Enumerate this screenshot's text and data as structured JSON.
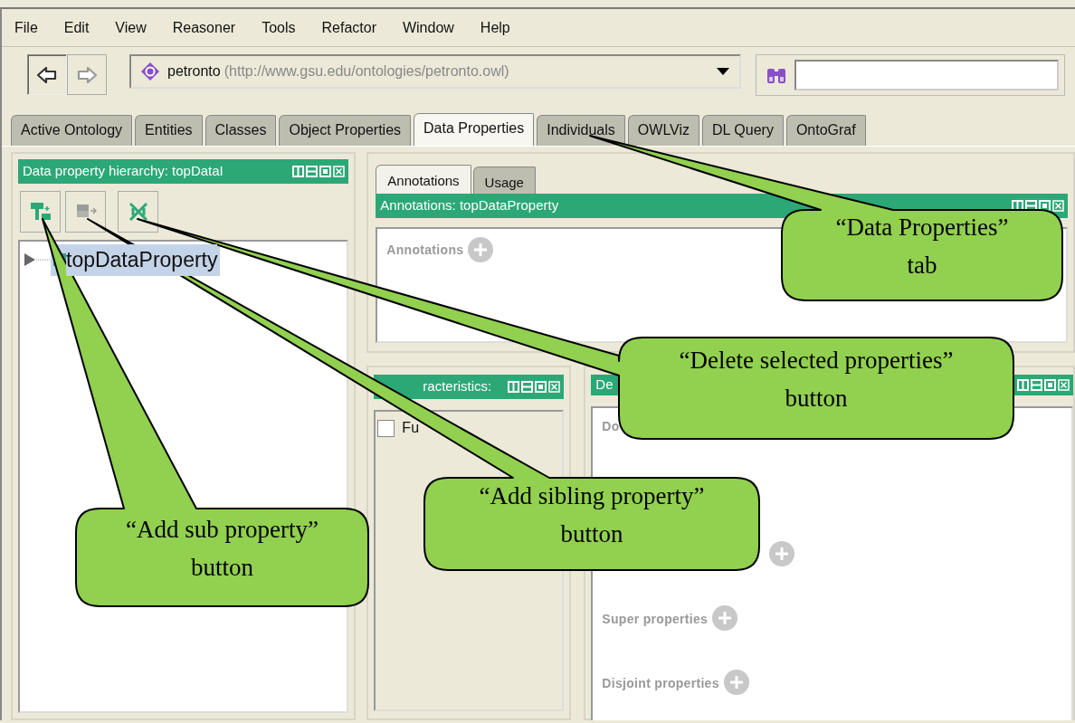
{
  "menu": [
    "File",
    "Edit",
    "View",
    "Reasoner",
    "Tools",
    "Refactor",
    "Window",
    "Help"
  ],
  "navigation": [
    {
      "kind": "back",
      "disabled": false
    },
    {
      "kind": "forward",
      "disabled": true
    }
  ],
  "ontology_selector": {
    "name": "petronto",
    "iri": "(http://www.gsu.edu/ontologies/petronto.owl)"
  },
  "tabs": [
    {
      "label": "Active Ontology",
      "selected": false
    },
    {
      "label": "Entities",
      "selected": false
    },
    {
      "label": "Classes",
      "selected": false
    },
    {
      "label": "Object Properties",
      "selected": false
    },
    {
      "label": "Data Properties",
      "selected": true
    },
    {
      "label": "Individuals",
      "selected": false
    },
    {
      "label": "OWLViz",
      "selected": false
    },
    {
      "label": "DL Query",
      "selected": false
    },
    {
      "label": "OntoGraf",
      "selected": false
    }
  ],
  "hierarchy_panel": {
    "title": "Data property hierarchy: topDataI",
    "tools": [
      {
        "kind": "add-sub",
        "disabled": false
      },
      {
        "kind": "add-sibling",
        "disabled": true
      },
      {
        "kind": "delete",
        "disabled": false
      }
    ],
    "tree": [
      {
        "label": "topDataProperty",
        "selected": true,
        "expanded": false
      }
    ]
  },
  "annotations_panel": {
    "tabs": [
      {
        "label": "Annotations",
        "selected": true
      },
      {
        "label": "Usage",
        "selected": false
      }
    ],
    "title": "Annotations: topDataProperty",
    "sections": [
      "Annotations"
    ]
  },
  "characteristics_panel": {
    "title": "racteristics:",
    "items": [
      {
        "label": "Fu",
        "checked": false
      }
    ]
  },
  "description_panel": {
    "title": "De",
    "sections": [
      {
        "label": "Do",
        "add": false
      },
      {
        "add": true
      },
      {
        "label": "Super properties",
        "add": true
      },
      {
        "label": "Disjoint properties",
        "add": true
      }
    ]
  },
  "callouts": [
    {
      "lines": [
        "“Data Properties”",
        "tab"
      ]
    },
    {
      "lines": [
        "“Delete selected properties”",
        "button"
      ]
    },
    {
      "lines": [
        "“Add sibling property”",
        "button"
      ]
    },
    {
      "lines": [
        "“Add sub property”",
        "button"
      ]
    }
  ]
}
